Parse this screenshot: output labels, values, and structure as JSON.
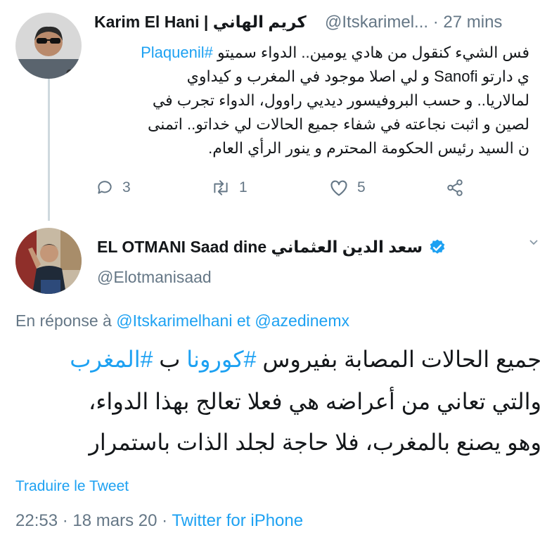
{
  "tweet1": {
    "author_name": "Karim El Hani | كريم الهاني",
    "handle": "@Itskarimel...",
    "time": "· 27 mins",
    "lines": [
      {
        "pre": "فس الشيء كنقول من هادي يومين.. الدواء سميتو ",
        "tag": "#Plaquenil"
      },
      {
        "pre": "ي دارتو Sanofi و لي اصلا موجود في المغرب و كيداوي"
      },
      {
        "pre": "لمالاريا.. و حسب البروفيسور ديديي راوول، الدواء تجرب في"
      },
      {
        "pre": "لصين و اثبت نجاعته في شفاء جميع الحالات لي خداتو.. اتمنى"
      },
      {
        "pre": "ن السيد رئيس الحكومة المحترم و ينور الرأي العام."
      }
    ],
    "actions": {
      "replies": "3",
      "retweets": "1",
      "likes": "5"
    }
  },
  "tweet2": {
    "author_name": "EL OTMANI Saad dine سعد الدين العثماني",
    "handle": "@Elotmanisaad",
    "reply_prefix": "En réponse à",
    "reply_to": "@Itskarimelhani et @azedinemx",
    "lines": [
      {
        "pre": "جميع الحالات المصابة بفيروس ",
        "tag1": "#كورونا",
        "mid": " ب ",
        "tag2": "#المغرب"
      },
      {
        "pre": "والتي تعاني من أعراضه هي فعلا تعالج بهذا الدواء،"
      },
      {
        "pre": "وهو يصنع بالمغرب، فلا حاجة لجلد الذات باستمرار"
      }
    ],
    "translate": "Traduire le Tweet",
    "time": "22:53 · 18 mars 20 · ",
    "source": "Twitter for iPhone"
  },
  "colors": {
    "accent": "#1da1f2",
    "muted": "#657786",
    "verified": "#1da1f2"
  }
}
